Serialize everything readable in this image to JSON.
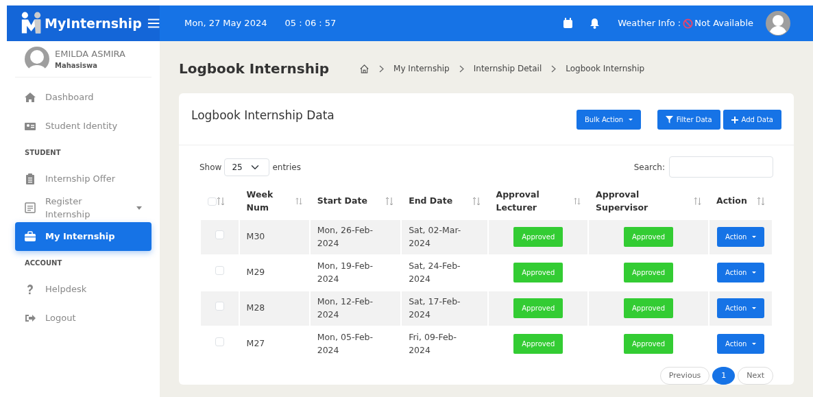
{
  "topbar": {
    "brand": "MyInternship",
    "date": "Mon, 27 May 2024",
    "time": "05 : 06 : 57",
    "weather_label": "Weather Info :",
    "weather_value": "Not Available"
  },
  "user": {
    "name": "EMILDA ASMIRA",
    "role": "Mahasiswa"
  },
  "sidebar": {
    "items": [
      {
        "kind": "link",
        "label": "Dashboard",
        "selected": false,
        "expandable": false
      },
      {
        "kind": "link",
        "label": "Student Identity",
        "selected": false,
        "expandable": false
      },
      {
        "kind": "section",
        "label": "STUDENT"
      },
      {
        "kind": "link",
        "label": "Internship Offer",
        "selected": false,
        "expandable": false
      },
      {
        "kind": "link",
        "label": "Register Internship",
        "selected": false,
        "expandable": true
      },
      {
        "kind": "link",
        "label": "My Internship",
        "selected": true,
        "expandable": false
      },
      {
        "kind": "section",
        "label": "ACCOUNT"
      },
      {
        "kind": "link",
        "label": "Helpdesk",
        "selected": false,
        "expandable": false
      },
      {
        "kind": "link",
        "label": "Logout",
        "selected": false,
        "expandable": false
      }
    ]
  },
  "page_title": "Logbook Internship",
  "breadcrumb": [
    "My Internship",
    "Internship Detail",
    "Logbook Internship"
  ],
  "card": {
    "title": "Logbook Internship Data",
    "buttons": [
      {
        "kind": "dropdown",
        "label": "Bulk Action"
      },
      {
        "kind": "filter",
        "label": "Filter Data"
      },
      {
        "kind": "add",
        "label": "Add Data"
      }
    ]
  },
  "table": {
    "show_label": "Show",
    "page_size": "25",
    "entries_label": "entries",
    "search_label": "Search:",
    "header_checked": false,
    "columns": [
      "Week Num",
      "Start Date",
      "End Date",
      "Approval Lecturer",
      "Approval Supervisor",
      "Action"
    ],
    "rows": [
      {
        "checked": false,
        "week": "M30",
        "start": "Mon, 26-Feb-2024",
        "end": "Sat, 02-Mar-2024",
        "lecturer": "Approved",
        "supervisor": "Approved",
        "action": "Action"
      },
      {
        "checked": false,
        "week": "M29",
        "start": "Mon, 19-Feb-2024",
        "end": "Sat, 24-Feb-2024",
        "lecturer": "Approved",
        "supervisor": "Approved",
        "action": "Action"
      },
      {
        "checked": false,
        "week": "M28",
        "start": "Mon, 12-Feb-2024",
        "end": "Sat, 17-Feb-2024",
        "lecturer": "Approved",
        "supervisor": "Approved",
        "action": "Action"
      },
      {
        "checked": false,
        "week": "M27",
        "start": "Mon, 05-Feb-2024",
        "end": "Fri, 09-Feb-2024",
        "lecturer": "Approved",
        "supervisor": "Approved",
        "action": "Action"
      }
    ]
  },
  "pagination": [
    {
      "label": "Previous",
      "selected": false
    },
    {
      "label": "1",
      "selected": true
    },
    {
      "label": "Next",
      "selected": false
    }
  ]
}
